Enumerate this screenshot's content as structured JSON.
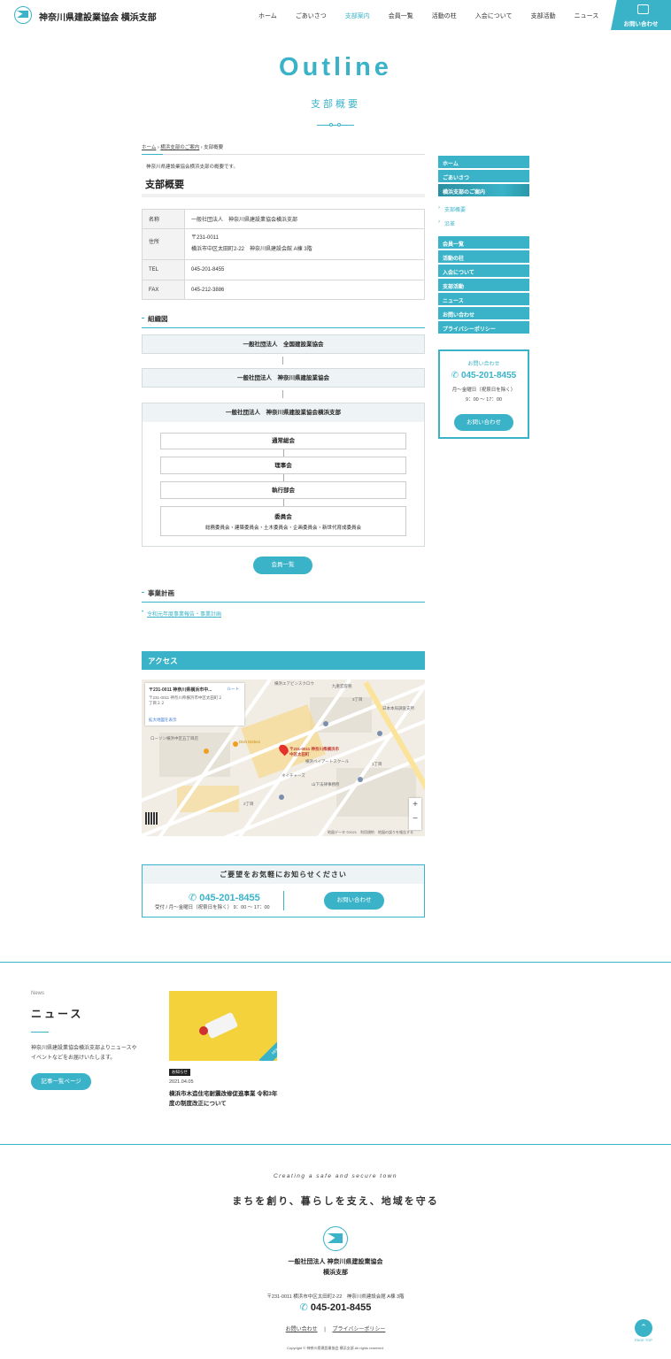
{
  "header": {
    "site_name": "神奈川県建設業協会 横浜支部",
    "nav": [
      "ホーム",
      "ごあいさつ",
      "支部案内",
      "会員一覧",
      "活動の柱",
      "入会について",
      "支部活動",
      "ニュース"
    ],
    "contact": "お問い合わせ",
    "accent": "#3ab3c8"
  },
  "page": {
    "title_en": "Outline",
    "title_jp": "支部概要"
  },
  "breadcrumb": {
    "home": "ホーム",
    "parent": "横浜支部のご案内",
    "current": "支部概要"
  },
  "intro": "神奈川県建設業協会横浜支部の概要です。",
  "heading": "支部概要",
  "info": {
    "name_key": "名称",
    "name_val": "一般社団法人　神奈川県建設業協会横浜支部",
    "addr_key": "住所",
    "addr_zip": "〒231-0011",
    "addr_val": "横浜市中区太田町2-22　神奈川県建設会館 A棟 3階",
    "tel_key": "TEL",
    "tel_val": "045-201-8455",
    "fax_key": "FAX",
    "fax_val": "045-212-3886"
  },
  "org": {
    "heading": "組織図",
    "national": "一般社団法人　全国建設業協会",
    "prefectural": "一般社団法人　神奈川県建設業協会",
    "branch": "一般社団法人　神奈川県建設業協会横浜支部",
    "general": "通常総会",
    "board": "理事会",
    "exec": "執行部会",
    "committee": "委員会",
    "committees": "総務委員会・建築委員会・土木委員会・企画委員会・新世代育成委員会",
    "members_button": "会員一覧"
  },
  "plan": {
    "heading": "事業計画",
    "link": "令和元年度事業報告・事業計画"
  },
  "access": {
    "heading": "アクセス",
    "map_card_title": "〒231-0011 神奈川県横浜市中...",
    "map_card_addr": "〒231-0011 神奈川県横浜市中区太田町２丁目２２",
    "map_card_route": "ルート",
    "map_card_link": "拡大地図を表示",
    "map_pin_label": "〒231-0011 神奈川県横浜市中区太田町",
    "labels": [
      "横浜エアビンスクロウ",
      "九重宏容税",
      "日本本局調査支所",
      "ローソン横浜中区五丁目店",
      "山下法律事務所",
      "横浜ベイアートスクール",
      "ネイチャーズ",
      "Dish Dishes",
      "1丁目",
      "2丁目",
      "3丁目"
    ],
    "map_footer": "地図データ ©2021　利用規約　地図の誤りを報告する"
  },
  "contact_box": {
    "heading": "ご要望をお気軽にお知らせください",
    "phone": "045-201-8455",
    "hours": "受付 / 月〜金曜日（祝祭日を除く） 9：00 〜 17：00",
    "button": "お問い合わせ"
  },
  "sidebar": {
    "items1": [
      "ホーム",
      "ごあいさつ",
      "横浜支部のご案内"
    ],
    "subitems": [
      "支部概要",
      "沿革"
    ],
    "items2": [
      "会員一覧",
      "活動の柱",
      "入会について",
      "支部活動",
      "ニュース",
      "お問い合わせ",
      "プライバシーポリシー"
    ],
    "contact_label": "お問い合わせ",
    "phone": "045-201-8455",
    "hours1": "月〜金曜日（祝祭日を除く）",
    "hours2": "9：00 〜 17：00",
    "contact_button": "お問い合わせ"
  },
  "news": {
    "label_en": "News",
    "heading": "ニュース",
    "desc": "神奈川県建設業協会横浜支部よりニュースやイベントなどをお届けいたします。",
    "button": "記事一覧ページ",
    "item_cat": "お知らせ",
    "item_date": "2021.04.05",
    "item_title": "横浜市木造住宅耐震改修促進事業 令和3年度の制度改正について",
    "item_badge": "NEW"
  },
  "footer": {
    "tagline_en": "Creating a safe and secure town",
    "tagline_jp": "まちを創り、暮らしを支え、地域を守る",
    "org1": "一般社団法人 神奈川県建設業協会",
    "org2": "横浜支部",
    "address": "〒231-0011 横浜市中区太田町2-22　神奈川県建設会館 A棟 3階",
    "phone": "045-201-8455",
    "link1": "お問い合わせ",
    "sep": "|",
    "link2": "プライバシーポリシー",
    "copyright": "Copyright © 神奈川県建設業協会 横浜支部 All rights reserved.",
    "pagetop": "PAGE TOP"
  }
}
